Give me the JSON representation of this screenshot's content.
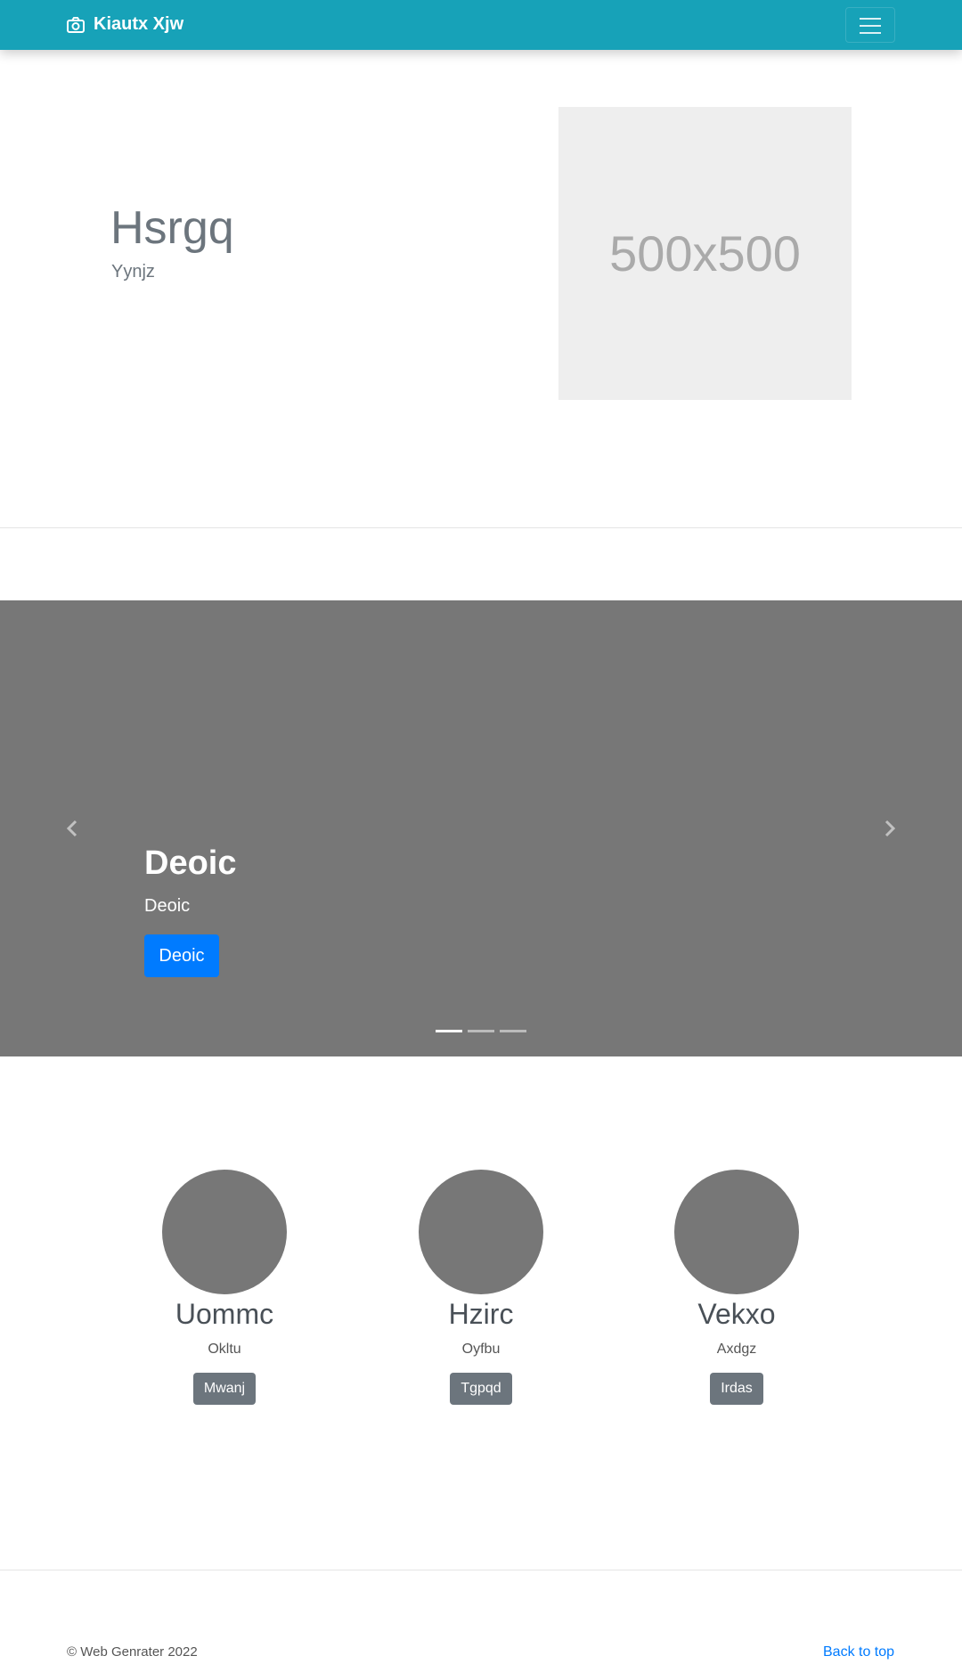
{
  "navbar": {
    "brand": "Kiautx Xjw",
    "bg": "#17a2b8"
  },
  "hero": {
    "title": "Hsrgq",
    "subtitle": "Yynjz",
    "image_placeholder": "500x500"
  },
  "carousel": {
    "title": "Deoic",
    "text": "Deoic",
    "button": "Deoic",
    "slides": 3,
    "active_slide": 1
  },
  "features": [
    {
      "name": "Uommc",
      "desc": "Okltu",
      "button": "Mwanj"
    },
    {
      "name": "Hzirc",
      "desc": "Oyfbu",
      "button": "Tgpqd"
    },
    {
      "name": "Vekxo",
      "desc": "Axdgz",
      "button": "Irdas"
    }
  ],
  "footer": {
    "copyright": "© Web Genrater 2022",
    "back_to_top": "Back to top"
  }
}
